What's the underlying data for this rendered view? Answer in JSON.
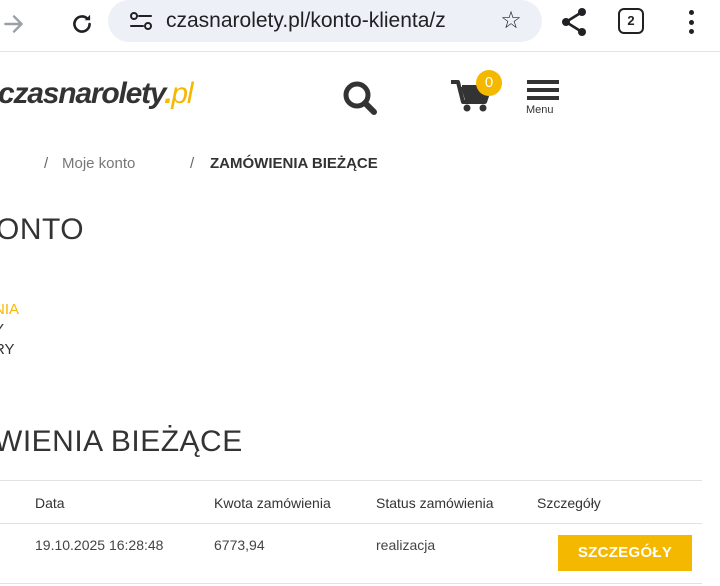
{
  "browser": {
    "url": "czasnarolety.pl/konto-klienta/z",
    "tab_count": "2"
  },
  "site": {
    "logo_main": "czasnarolety",
    "logo_dot": ".",
    "logo_tld": "pl",
    "cart_count": "0",
    "menu_label": "Menu",
    "accent_color": "#f5b800"
  },
  "breadcrumb": {
    "sep1": "/",
    "item1": "Moje konto",
    "sep2": "/",
    "current": "ZAMÓWIENIA BIEŻĄCE"
  },
  "account": {
    "heading": "ONTO",
    "menu": [
      "NIA",
      "Y",
      "RY"
    ],
    "orders_heading": "WIENIA BIEŻĄCE"
  },
  "table": {
    "headers": [
      "Data",
      "Kwota zamówienia",
      "Status zamówienia",
      "Szczegóły"
    ],
    "rows": [
      {
        "date": "19.10.2025 16:28:48",
        "amount": "6773,94",
        "status": "realizacja",
        "action": "SZCZEGÓŁY"
      }
    ]
  }
}
